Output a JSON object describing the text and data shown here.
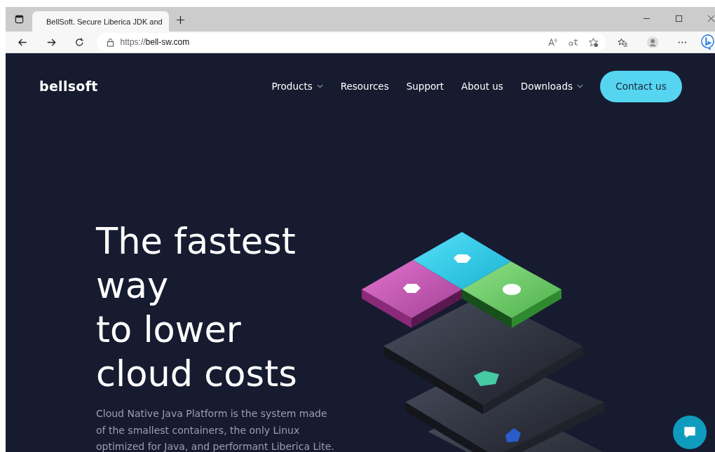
{
  "browser": {
    "tab_title": "BellSoft. Secure Liberica JDK and",
    "url_prefix": "https://",
    "url_host": "bell-sw.com"
  },
  "site": {
    "logo": "bellsoft",
    "nav": [
      {
        "label": "Products",
        "dropdown": true
      },
      {
        "label": "Resources",
        "dropdown": false
      },
      {
        "label": "Support",
        "dropdown": false
      },
      {
        "label": "About us",
        "dropdown": false
      },
      {
        "label": "Downloads",
        "dropdown": true
      }
    ],
    "cta": "Contact us",
    "hero": {
      "title_lines": [
        "The fastest",
        "way",
        "to lower",
        "cloud costs"
      ],
      "description": "Cloud Native Java Platform is the system made of the smallest containers, the only Linux optimized for Java, and performant Liberica Lite."
    }
  }
}
